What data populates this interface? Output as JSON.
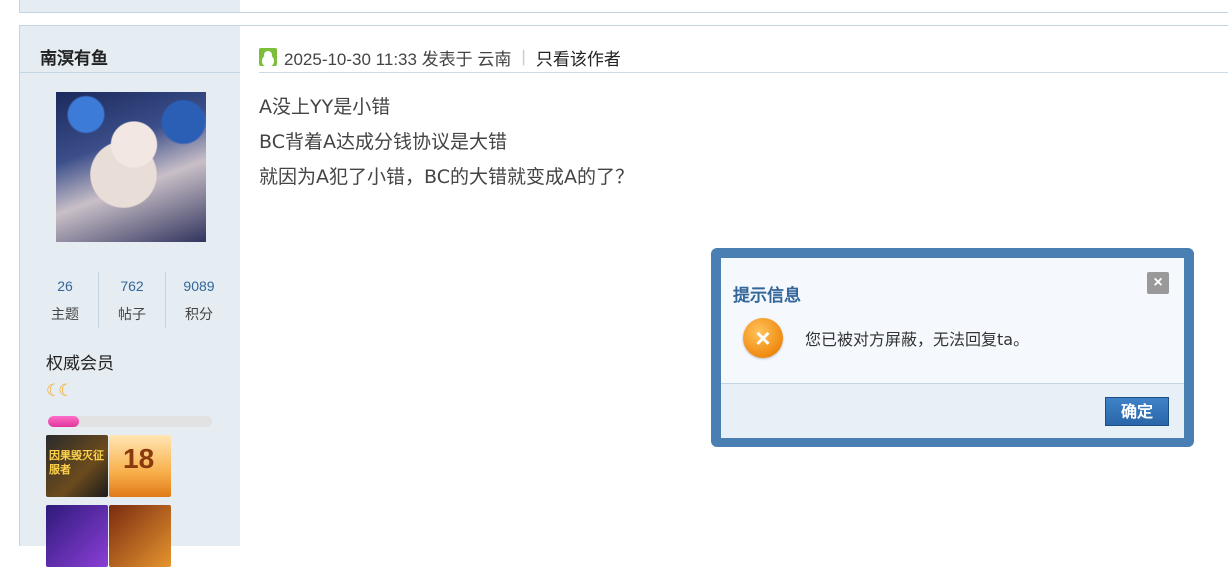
{
  "author": {
    "name": "南溟有鱼",
    "stats": [
      {
        "num": "26",
        "label": "主题"
      },
      {
        "num": "762",
        "label": "帖子"
      },
      {
        "num": "9089",
        "label": "积分"
      }
    ],
    "group": "权威会员",
    "stars": "☾☾",
    "level_progress": 0.19
  },
  "medals": [
    {
      "name": "因果毁灭征服者",
      "text": "因果毁灭征服者"
    },
    {
      "name": "18周年蛋糕",
      "text": "18"
    }
  ],
  "post": {
    "meta": "2025-10-30 11:33 发表于 云南",
    "separator": "|",
    "author_only": "只看该作者",
    "lines": [
      "A没上YY是小错",
      "BC背着A达成分钱协议是大错",
      "就因为A犯了小错，BC的大错就变成A的了？"
    ]
  },
  "dialog": {
    "title": "提示信息",
    "close": "×",
    "error_icon": "×",
    "message": "您已被对方屏蔽，无法回复ta。",
    "ok": "确定"
  },
  "colors": {
    "sidebar_bg": "#e5edf2",
    "dialog_border": "#4a7fb4",
    "dialog_title": "#336699",
    "level_fill": "#e0359b"
  }
}
